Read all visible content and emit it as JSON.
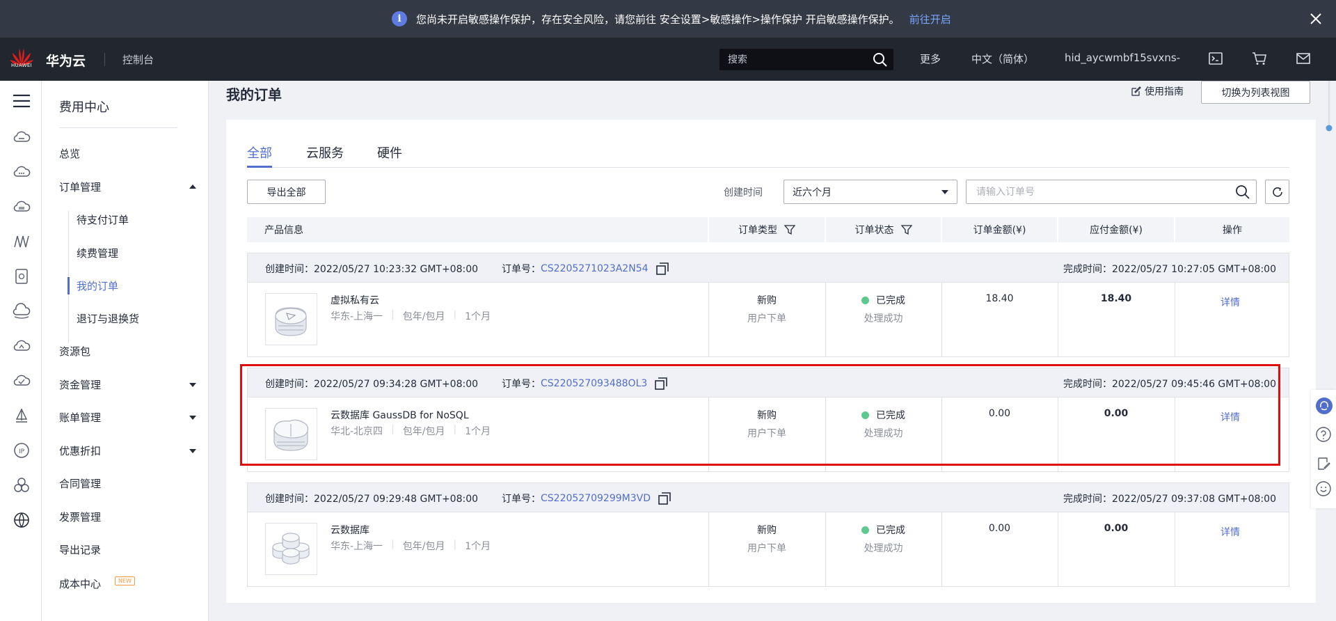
{
  "banner": {
    "message": "您尚未开启敏感操作保护，存在安全风险，请您前往 安全设置>敏感操作>操作保护 开启敏感操作保护。",
    "link": "前往开启"
  },
  "topbar": {
    "logo_text": "HUAWEI",
    "brand": "华为云",
    "console": "控制台",
    "search_placeholder": "搜索",
    "more": "更多",
    "language": "中文（简体）",
    "username": "hid_aycwmbf15svxns-"
  },
  "sidebar": {
    "title": "费用中心",
    "overview": "总览",
    "order_mgmt": "订单管理",
    "sub_items": [
      "待支付订单",
      "续费管理",
      "我的订单",
      "退订与退换货"
    ],
    "items": [
      "资源包",
      "资金管理",
      "账单管理",
      "优惠折扣",
      "合同管理",
      "发票管理",
      "导出记录",
      "成本中心"
    ],
    "new_badge": "NEW"
  },
  "page": {
    "title": "我的订单",
    "guide": "使用指南",
    "switch_view": "切换为列表视图"
  },
  "tabs": [
    "全部",
    "云服务",
    "硬件"
  ],
  "filters": {
    "export_all": "导出全部",
    "created_time_label": "创建时间",
    "period": "近六个月",
    "order_placeholder": "请输入订单号"
  },
  "table_headers": [
    "产品信息",
    "订单类型",
    "订单状态",
    "订单金额(¥)",
    "应付金额(¥)",
    "操作"
  ],
  "orders": [
    {
      "created": "创建时间：2022/05/27 10:23:32 GMT+08:00",
      "order_no_label": "订单号：",
      "order_no": "CS2205271023A2N54",
      "completed": "完成时间：2022/05/27 10:27:05 GMT+08:00",
      "product": "虚拟私有云",
      "region": "华东-上海一",
      "billing": "包年/包月",
      "duration": "1个月",
      "type": "新购",
      "type_sub": "用户下单",
      "status": "已完成",
      "status_sub": "处理成功",
      "amount": "18.40",
      "payable": "18.40",
      "action": "详情"
    },
    {
      "created": "创建时间：2022/05/27 09:34:28 GMT+08:00",
      "order_no_label": "订单号：",
      "order_no": "CS220527093488OL3",
      "completed": "完成时间：2022/05/27 09:45:46 GMT+08:00",
      "product": "云数据库 GaussDB for NoSQL",
      "region": "华北-北京四",
      "billing": "包年/包月",
      "duration": "1个月",
      "type": "新购",
      "type_sub": "用户下单",
      "status": "已完成",
      "status_sub": "处理成功",
      "amount": "0.00",
      "payable": "0.00",
      "action": "详情"
    },
    {
      "created": "创建时间：2022/05/27 09:29:48 GMT+08:00",
      "order_no_label": "订单号：",
      "order_no": "CS22052709299M3VD",
      "completed": "完成时间：2022/05/27 09:37:08 GMT+08:00",
      "product": "云数据库",
      "region": "华东-上海一",
      "billing": "包年/包月",
      "duration": "1个月",
      "type": "新购",
      "type_sub": "用户下单",
      "status": "已完成",
      "status_sub": "处理成功",
      "amount": "0.00",
      "payable": "0.00",
      "action": "详情"
    }
  ],
  "colors": {
    "accent": "#526ecc",
    "success": "#5dc98f",
    "highlight": "#e00d0d",
    "banner_bg": "#333945",
    "header_bg": "#22262f"
  }
}
